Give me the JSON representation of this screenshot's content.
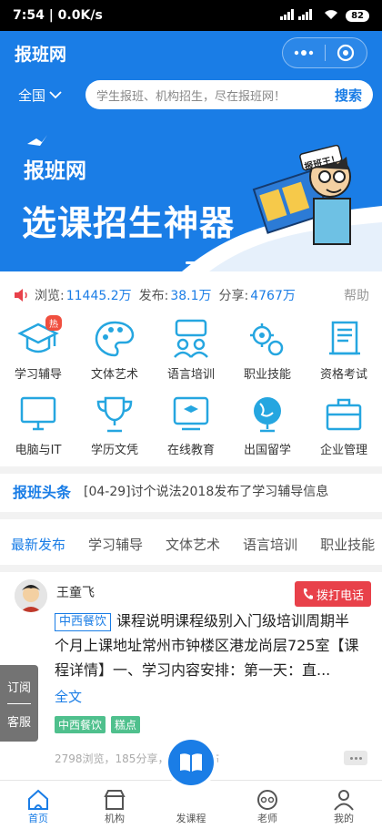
{
  "status_bar": {
    "time_speed": "7:54 | 0.0K/s",
    "signal_text": "4G",
    "battery": "82"
  },
  "app_bar": {
    "title": "报班网"
  },
  "search": {
    "region": "全国",
    "placeholder": "学生报班、机构招生，尽在报班网！",
    "button": "搜索"
  },
  "banner": {
    "brand": "报班网",
    "slogan": "选课招生神器",
    "sign_text": "报班王！"
  },
  "stats": {
    "views_label": "浏览:",
    "views_value": "11445.2万",
    "posts_label": "发布:",
    "posts_value": "38.1万",
    "shares_label": "分享:",
    "shares_value": "4767万",
    "help": "帮助"
  },
  "categories": [
    {
      "label": "学习辅导",
      "icon": "graduation-cap-icon",
      "badge": "热"
    },
    {
      "label": "文体艺术",
      "icon": "palette-icon"
    },
    {
      "label": "语言培训",
      "icon": "chat-people-icon"
    },
    {
      "label": "职业技能",
      "icon": "gears-icon"
    },
    {
      "label": "资格考试",
      "icon": "scroll-icon"
    },
    {
      "label": "电脑与IT",
      "icon": "monitor-icon"
    },
    {
      "label": "学历文凭",
      "icon": "trophy-icon"
    },
    {
      "label": "在线教育",
      "icon": "online-class-icon"
    },
    {
      "label": "出国留学",
      "icon": "globe-icon"
    },
    {
      "label": "企业管理",
      "icon": "briefcase-icon"
    }
  ],
  "headline": {
    "title": "报班头条",
    "text": "[04-29]讨个说法2018发布了学习辅导信息"
  },
  "tabs": [
    "最新发布",
    "学习辅导",
    "文体艺术",
    "语言培训",
    "职业技能"
  ],
  "post": {
    "author": "王童飞",
    "call_button": "拨打电话",
    "category_tag": "中西餐饮",
    "title": "课程说明课程级别入门级培训周期半个月上课地址常州市钟楼区港龙尚层725室【课程详情】一、学习内容安排：第一天：直...",
    "fulltext": "全文",
    "tags": [
      "中西餐饮",
      "糕点"
    ],
    "meta": "2798浏览，185分享，5天前发布"
  },
  "float_side": {
    "top": "订阅",
    "bottom": "客服"
  },
  "tab_bar": [
    {
      "label": "首页",
      "icon": "home-icon"
    },
    {
      "label": "机构",
      "icon": "shop-icon"
    },
    {
      "label": "发课程",
      "icon": "book-icon"
    },
    {
      "label": "老师",
      "icon": "teacher-icon"
    },
    {
      "label": "我的",
      "icon": "person-icon"
    }
  ],
  "colors": {
    "primary": "#1a7de6",
    "call_red": "#e8414a",
    "tag_green": "#4fc08d"
  }
}
